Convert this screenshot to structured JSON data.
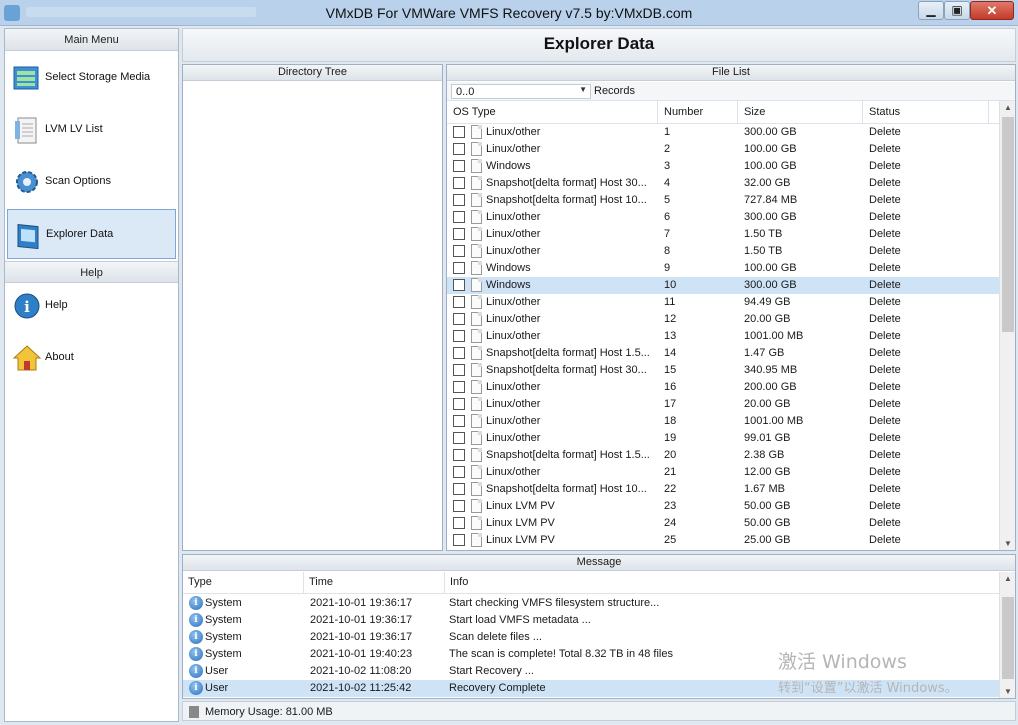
{
  "window": {
    "title": "VMxDB For VMWare VMFS Recovery v7.5 by:VMxDB.com"
  },
  "sidebar": {
    "main_menu_header": "Main Menu",
    "main_items": [
      {
        "label": "Select Storage Media",
        "icon": "storage-media-icon"
      },
      {
        "label": "LVM LV List",
        "icon": "list-icon"
      },
      {
        "label": "Scan Options",
        "icon": "gear-icon"
      },
      {
        "label": "Explorer Data",
        "icon": "explorer-icon",
        "active": true
      }
    ],
    "help_header": "Help",
    "help_items": [
      {
        "label": "Help",
        "icon": "info-icon"
      },
      {
        "label": "About",
        "icon": "home-icon"
      }
    ]
  },
  "banner": {
    "title": "Explorer Data"
  },
  "directory_tree": {
    "header": "Directory Tree"
  },
  "file_list": {
    "header": "File List",
    "range_value": "0..0",
    "records_label": "Records",
    "columns": [
      "OS Type",
      "Number",
      "Size",
      "Status"
    ],
    "rows": [
      {
        "os": "Linux/other",
        "num": "1",
        "size": "300.00 GB",
        "status": "Delete"
      },
      {
        "os": "Linux/other",
        "num": "2",
        "size": "100.00 GB",
        "status": "Delete"
      },
      {
        "os": "Windows",
        "num": "3",
        "size": "100.00 GB",
        "status": "Delete"
      },
      {
        "os": "Snapshot[delta format] Host 30...",
        "num": "4",
        "size": "32.00 GB",
        "status": "Delete"
      },
      {
        "os": "Snapshot[delta format] Host 10...",
        "num": "5",
        "size": "727.84 MB",
        "status": "Delete"
      },
      {
        "os": "Linux/other",
        "num": "6",
        "size": "300.00 GB",
        "status": "Delete"
      },
      {
        "os": "Linux/other",
        "num": "7",
        "size": "1.50 TB",
        "status": "Delete"
      },
      {
        "os": "Linux/other",
        "num": "8",
        "size": "1.50 TB",
        "status": "Delete"
      },
      {
        "os": "Windows",
        "num": "9",
        "size": "100.00 GB",
        "status": "Delete"
      },
      {
        "os": "Windows",
        "num": "10",
        "size": "300.00 GB",
        "status": "Delete",
        "selected": true
      },
      {
        "os": "Linux/other",
        "num": "11",
        "size": "94.49 GB",
        "status": "Delete"
      },
      {
        "os": "Linux/other",
        "num": "12",
        "size": "20.00 GB",
        "status": "Delete"
      },
      {
        "os": "Linux/other",
        "num": "13",
        "size": "1001.00 MB",
        "status": "Delete"
      },
      {
        "os": "Snapshot[delta format] Host 1.5...",
        "num": "14",
        "size": "1.47 GB",
        "status": "Delete"
      },
      {
        "os": "Snapshot[delta format] Host 30...",
        "num": "15",
        "size": "340.95 MB",
        "status": "Delete"
      },
      {
        "os": "Linux/other",
        "num": "16",
        "size": "200.00 GB",
        "status": "Delete"
      },
      {
        "os": "Linux/other",
        "num": "17",
        "size": "20.00 GB",
        "status": "Delete"
      },
      {
        "os": "Linux/other",
        "num": "18",
        "size": "1001.00 MB",
        "status": "Delete"
      },
      {
        "os": "Linux/other",
        "num": "19",
        "size": "99.01 GB",
        "status": "Delete"
      },
      {
        "os": "Snapshot[delta format] Host 1.5...",
        "num": "20",
        "size": "2.38 GB",
        "status": "Delete"
      },
      {
        "os": "Linux/other",
        "num": "21",
        "size": "12.00 GB",
        "status": "Delete"
      },
      {
        "os": "Snapshot[delta format] Host 10...",
        "num": "22",
        "size": "1.67 MB",
        "status": "Delete"
      },
      {
        "os": "Linux LVM PV",
        "num": "23",
        "size": "50.00 GB",
        "status": "Delete"
      },
      {
        "os": "Linux LVM PV",
        "num": "24",
        "size": "50.00 GB",
        "status": "Delete"
      },
      {
        "os": "Linux LVM PV",
        "num": "25",
        "size": "25.00 GB",
        "status": "Delete"
      }
    ]
  },
  "messages": {
    "header": "Message",
    "columns": [
      "Type",
      "Time",
      "Info"
    ],
    "rows": [
      {
        "type": "System",
        "time": "2021-10-01 19:36:17",
        "info": "Start checking VMFS filesystem structure..."
      },
      {
        "type": "System",
        "time": "2021-10-01 19:36:17",
        "info": "Start load VMFS metadata ..."
      },
      {
        "type": "System",
        "time": "2021-10-01 19:36:17",
        "info": "Scan delete files ..."
      },
      {
        "type": "System",
        "time": "2021-10-01 19:40:23",
        "info": "The scan is complete!  Total 8.32 TB  in 48 files"
      },
      {
        "type": "User",
        "time": "2021-10-02 11:08:20",
        "info": "Start Recovery ..."
      },
      {
        "type": "User",
        "time": "2021-10-02 11:25:42",
        "info": "Recovery Complete",
        "selected": true
      }
    ]
  },
  "status_bar": {
    "memory": "Memory Usage: 81.00 MB"
  },
  "watermark": {
    "line1": "激活 Windows",
    "line2": "转到“设置”以激活 Windows。"
  },
  "colors": {
    "selection": "#cfe3f7",
    "titlebar": "#b9d1ea"
  }
}
